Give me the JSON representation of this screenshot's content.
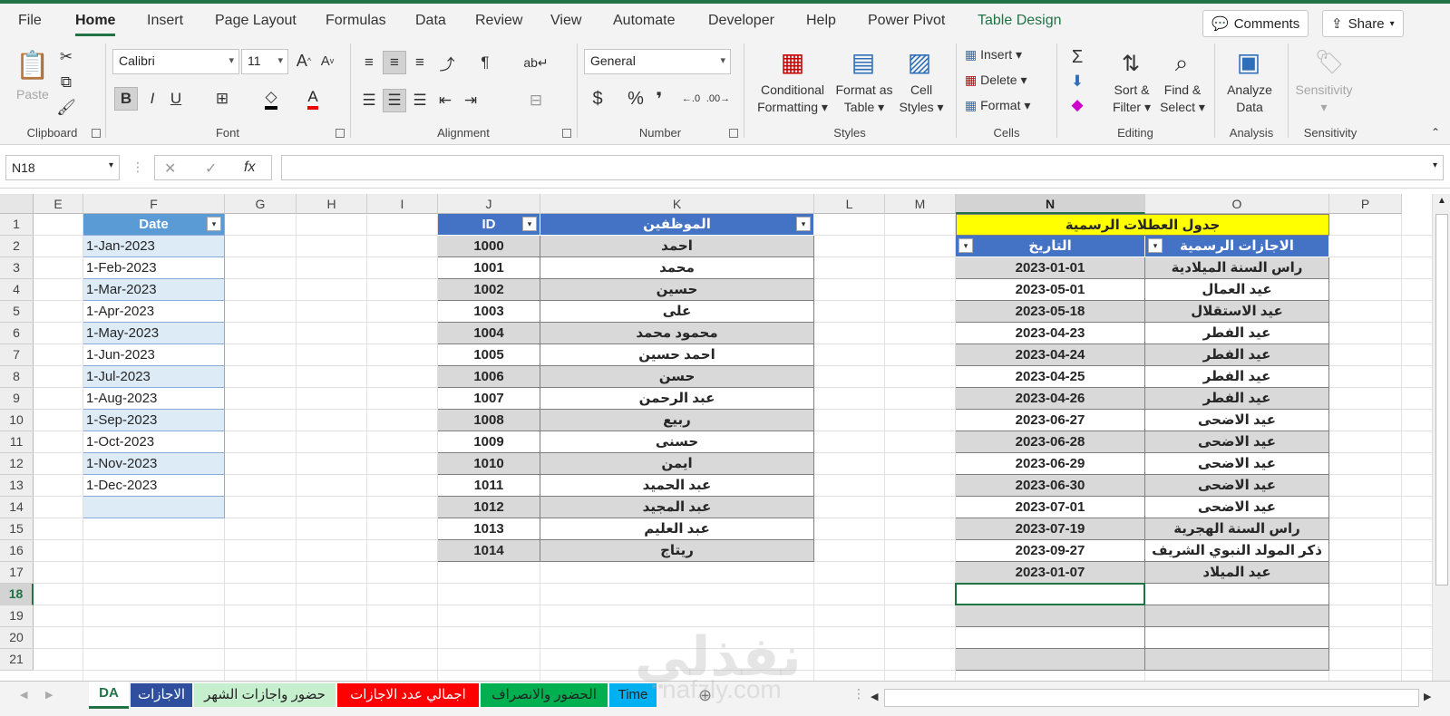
{
  "menu": {
    "tabs": [
      "File",
      "Home",
      "Insert",
      "Page Layout",
      "Formulas",
      "Data",
      "Review",
      "View",
      "Automate",
      "Developer",
      "Help",
      "Power Pivot",
      "Table Design"
    ],
    "comments": "Comments",
    "share": "Share"
  },
  "ribbon": {
    "clipboard": {
      "label": "Clipboard",
      "paste": "Paste"
    },
    "font": {
      "label": "Font",
      "name": "Calibri",
      "size": "11",
      "bold": "B",
      "italic": "I",
      "underline": "U",
      "grow": "A",
      "shrink": "A"
    },
    "alignment": {
      "label": "Alignment"
    },
    "number": {
      "label": "Number",
      "format": "General",
      "currency": "$",
      "percent": "%",
      "comma": "❜"
    },
    "styles": {
      "label": "Styles",
      "conditional": [
        "Conditional",
        "Formatting"
      ],
      "format_table": [
        "Format as",
        "Table"
      ],
      "cell_styles": [
        "Cell",
        "Styles"
      ]
    },
    "cells": {
      "label": "Cells",
      "insert": "Insert",
      "delete": "Delete",
      "format": "Format"
    },
    "editing": {
      "label": "Editing",
      "sort": [
        "Sort &",
        "Filter"
      ],
      "find": [
        "Find &",
        "Select"
      ]
    },
    "analysis": {
      "label": "Analysis",
      "analyze": [
        "Analyze",
        "Data"
      ]
    },
    "sensitivity": {
      "label": "Sensitivity",
      "button": "Sensitivity"
    }
  },
  "formula_bar": {
    "name_box": "N18",
    "fx": "fx",
    "content": ""
  },
  "columns": [
    "E",
    "F",
    "G",
    "H",
    "I",
    "J",
    "K",
    "L",
    "M",
    "N",
    "O",
    "P"
  ],
  "rows": [
    "1",
    "2",
    "3",
    "4",
    "5",
    "6",
    "7",
    "8",
    "9",
    "10",
    "11",
    "12",
    "13",
    "14",
    "15",
    "16",
    "17",
    "18",
    "19",
    "20",
    "21"
  ],
  "table_dates": {
    "header": "Date",
    "values": [
      "1-Jan-2023",
      "1-Feb-2023",
      "1-Mar-2023",
      "1-Apr-2023",
      "1-May-2023",
      "1-Jun-2023",
      "1-Jul-2023",
      "1-Aug-2023",
      "1-Sep-2023",
      "1-Oct-2023",
      "1-Nov-2023",
      "1-Dec-2023",
      ""
    ]
  },
  "table_employees": {
    "headers": [
      "ID",
      "الموظفين"
    ],
    "rows": [
      [
        "1000",
        "احمد"
      ],
      [
        "1001",
        "محمد"
      ],
      [
        "1002",
        "حسين"
      ],
      [
        "1003",
        "على"
      ],
      [
        "1004",
        "محمود محمد"
      ],
      [
        "1005",
        "احمد حسين"
      ],
      [
        "1006",
        "حسن"
      ],
      [
        "1007",
        "عبد الرحمن"
      ],
      [
        "1008",
        "ربيع"
      ],
      [
        "1009",
        "حسنى"
      ],
      [
        "1010",
        "ايمن"
      ],
      [
        "1011",
        "عبد الحميد"
      ],
      [
        "1012",
        "عبد المجيد"
      ],
      [
        "1013",
        "عبد العليم"
      ],
      [
        "1014",
        "ريتاج"
      ]
    ]
  },
  "table_holidays": {
    "title": "جدول العطلات الرسمية",
    "headers": [
      "التاريخ",
      "الاجازات الرسمية"
    ],
    "rows": [
      [
        "2023-01-01",
        "راس السنة الميلادية"
      ],
      [
        "2023-05-01",
        "عيد العمال"
      ],
      [
        "2023-05-18",
        "عيد الاستقلال"
      ],
      [
        "2023-04-23",
        "عيد الفطر"
      ],
      [
        "2023-04-24",
        "عيد الفطر"
      ],
      [
        "2023-04-25",
        "عيد الفطر"
      ],
      [
        "2023-04-26",
        "عيد الفطر"
      ],
      [
        "2023-06-27",
        "عيد الاضحى"
      ],
      [
        "2023-06-28",
        "عيد الاضحى"
      ],
      [
        "2023-06-29",
        "عيد الاضحى"
      ],
      [
        "2023-06-30",
        "عيد الاضحى"
      ],
      [
        "2023-07-01",
        "عيد الاضحى"
      ],
      [
        "2023-07-19",
        "راس السنة الهجرية"
      ],
      [
        "2023-09-27",
        "ذكر المولد النبوي الشريف"
      ],
      [
        "2023-01-07",
        "عيد الميلاد"
      ]
    ]
  },
  "sheets": [
    {
      "name": "DA",
      "color": "#ffffff",
      "text": "#217346"
    },
    {
      "name": "الاجازات",
      "color": "#2f4f9e",
      "text": "#ffffff"
    },
    {
      "name": "حضور واجازات الشهر",
      "color": "#c6efce",
      "text": "#222222"
    },
    {
      "name": "اجمالي عدد الاجازات",
      "color": "#ff0000",
      "text": "#ffffff"
    },
    {
      "name": "الحضور والانصراف",
      "color": "#00b050",
      "text": "#222222"
    },
    {
      "name": "Time",
      "color": "#00b0f0",
      "text": "#222222"
    }
  ],
  "watermark": {
    "text": "نفذلي",
    "sub": "nafzly.com"
  }
}
